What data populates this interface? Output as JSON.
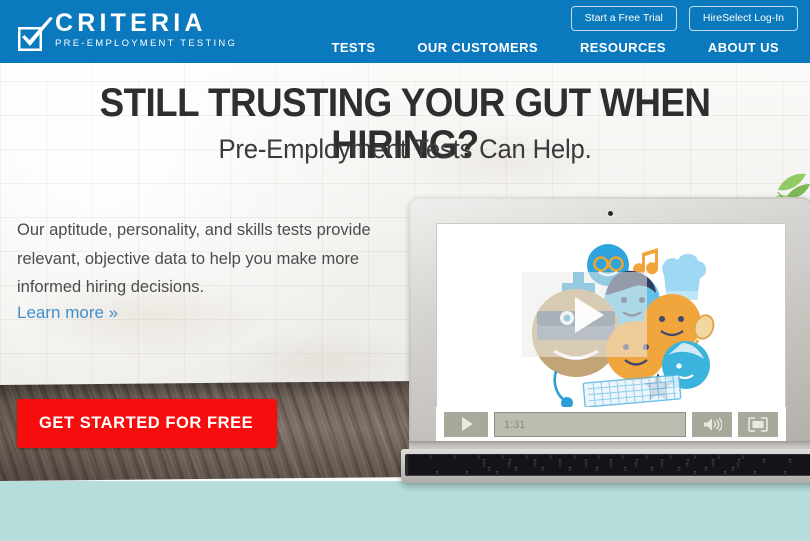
{
  "header": {
    "logo": {
      "icon": "checkbox-check-icon",
      "name": "CRITERIA",
      "tagline": "PRE-EMPLOYMENT TESTING"
    },
    "buttons": [
      {
        "label": "Start a Free Trial",
        "name": "start-free-trial-button"
      },
      {
        "label": "HireSelect Log-In",
        "name": "hireselect-login-button"
      }
    ],
    "nav": [
      {
        "label": "TESTS",
        "name": "nav-tests"
      },
      {
        "label": "OUR CUSTOMERS",
        "name": "nav-our-customers"
      },
      {
        "label": "RESOURCES",
        "name": "nav-resources"
      },
      {
        "label": "ABOUT US",
        "name": "nav-about-us"
      }
    ],
    "background_color": "#0b79bd"
  },
  "hero": {
    "headline": "STILL TRUSTING YOUR GUT WHEN HIRING?",
    "subheadline": "Pre-Employment Tests Can Help.",
    "body": "Our aptitude, personality, and skills tests provide relevant, objective data to help you make more informed hiring decisions.",
    "learn_more": "Learn more »",
    "learn_more_color": "#3e8ed0",
    "cta_label": "GET STARTED FOR FREE",
    "cta_color": "#f70d0d"
  },
  "video": {
    "play_button": "play-icon",
    "timecode": "1:31",
    "volume_icon": "volume-icon",
    "fullscreen_icon": "fullscreen-icon"
  },
  "footer_band": {
    "color": "#b5dedb"
  }
}
